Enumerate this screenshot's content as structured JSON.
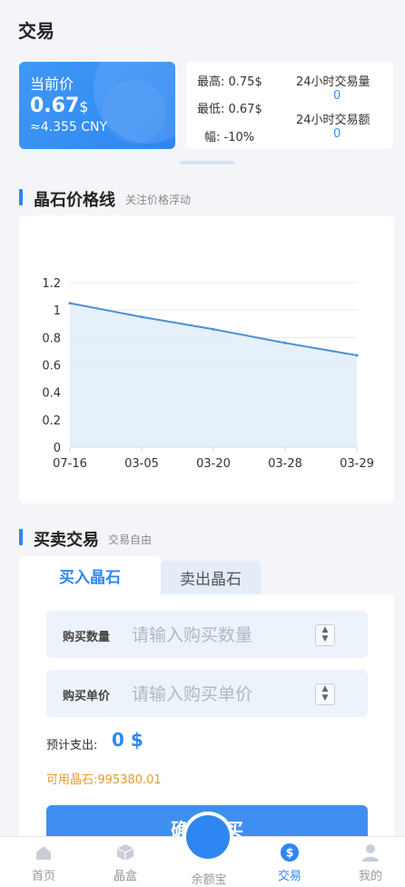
{
  "header": {
    "title": "交易"
  },
  "price": {
    "label": "当前价",
    "value": "0.67",
    "unit": "$",
    "cny": "≈4.355 CNY"
  },
  "stats": {
    "high": "最高: 0.75$",
    "low": "最低: 0.67$",
    "change": "幅: -10%",
    "volume_label": "24小时交易量",
    "volume_value": "0",
    "amount_label": "24小时交易额",
    "amount_value": "0"
  },
  "chart_section": {
    "title": "晶石价格线",
    "subtitle": "关注价格浮动"
  },
  "chart_data": {
    "type": "area",
    "categories": [
      "07-16",
      "03-05",
      "03-20",
      "03-28",
      "03-29"
    ],
    "series": [
      {
        "values": [
          1.05,
          0.95,
          0.86,
          0.76,
          0.67
        ]
      }
    ],
    "y_ticks": [
      "0",
      "0.2",
      "0.4",
      "0.6",
      "0.8",
      "1",
      "1.2"
    ],
    "ylim": [
      0,
      1.2
    ],
    "grid": true,
    "line_color": "#4d90d8",
    "fill_color": "#e3eefb"
  },
  "trade_section": {
    "title": "买卖交易",
    "subtitle": "交易自由"
  },
  "trade": {
    "tab_buy": "买入晶石",
    "tab_sell": "卖出晶石",
    "qty_label": "购买数量",
    "qty_placeholder": "请输入购买数量",
    "price_label": "购买单价",
    "price_placeholder": "请输入购买单价",
    "expect_label": "预计支出:",
    "expect_value": "0 $",
    "available": "可用晶石:995380.01",
    "confirm": "确认购买"
  },
  "tabbar": {
    "home": "首页",
    "box": "晶盒",
    "balance": "余额宝",
    "trade": "交易",
    "mine": "我的"
  },
  "colors": {
    "accent": "#2f86f2",
    "orange": "#e89a2e"
  }
}
